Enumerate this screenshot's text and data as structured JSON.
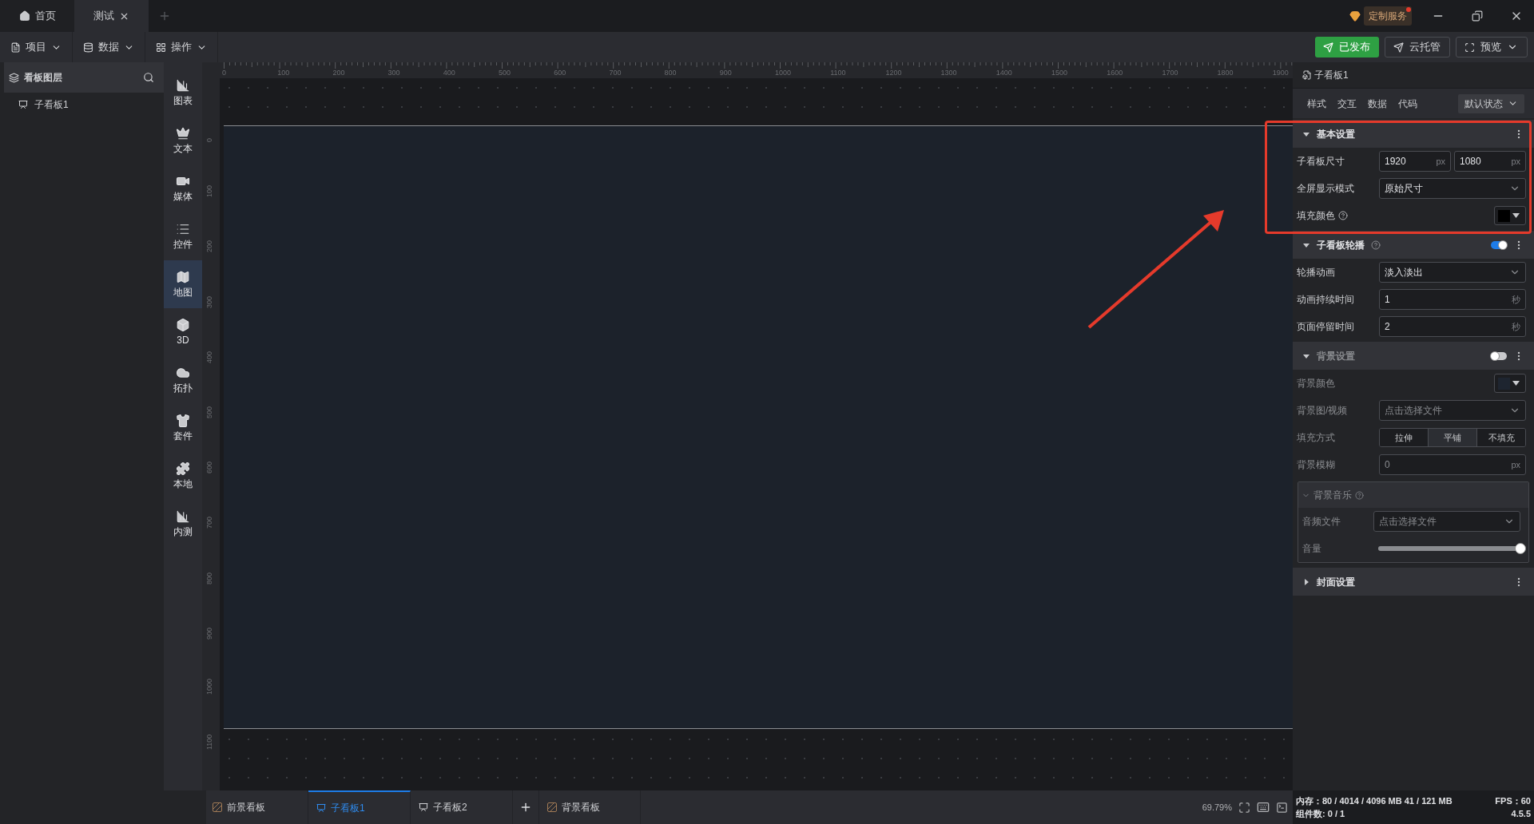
{
  "tabs": [
    {
      "label": "首页",
      "kind": "home",
      "selected": false
    },
    {
      "label": "测试",
      "kind": "doc",
      "selected": true
    }
  ],
  "custom_service": {
    "label": "定制服务",
    "notification": true
  },
  "menus": [
    "项目",
    "数据",
    "操作"
  ],
  "actions": [
    {
      "label": "已发布",
      "kind": "primary"
    },
    {
      "label": "云托管",
      "kind": "outline"
    },
    {
      "label": "预览",
      "kind": "dropdown"
    }
  ],
  "layers_panel": {
    "title": "看板图层",
    "items": [
      {
        "label": "子看板1"
      }
    ]
  },
  "component_bar": [
    {
      "label": "图表",
      "selected": false
    },
    {
      "label": "文本",
      "selected": false
    },
    {
      "label": "媒体",
      "selected": false
    },
    {
      "label": "控件",
      "selected": false
    },
    {
      "label": "地图",
      "selected": true
    },
    {
      "label": "3D",
      "selected": false
    },
    {
      "label": "拓扑",
      "selected": false
    },
    {
      "label": "套件",
      "selected": false
    },
    {
      "label": "本地",
      "selected": false
    },
    {
      "label": "内测",
      "selected": false
    }
  ],
  "ruler": {
    "x_labels": [
      "0",
      "100",
      "200",
      "300",
      "400",
      "500",
      "600",
      "700",
      "800",
      "900",
      "1000",
      "1100",
      "1200",
      "1300",
      "1400",
      "1500",
      "1600",
      "1700",
      "1800",
      "1900"
    ],
    "y_labels": [
      "0",
      "100",
      "200",
      "300",
      "400",
      "500",
      "600",
      "700",
      "800",
      "900",
      "1000",
      "1100"
    ]
  },
  "properties": {
    "title": "子看板1",
    "tabs": [
      "样式",
      "交互",
      "数据",
      "代码"
    ],
    "state_select": "默认状态",
    "sections": [
      {
        "title": "基本设置",
        "expanded": true,
        "rows": [
          {
            "kind": "size",
            "label": "子看板尺寸",
            "values": [
              {
                "value": "1920",
                "unit": "px"
              },
              {
                "value": "1080",
                "unit": "px"
              }
            ]
          },
          {
            "kind": "select",
            "label": "全屏显示模式",
            "value": "原始尺寸"
          },
          {
            "kind": "color",
            "label": "填充颜色",
            "help": true,
            "color": "#000000"
          }
        ]
      },
      {
        "title": "子看板轮播",
        "expanded": true,
        "help": true,
        "toggle": true,
        "rows": [
          {
            "kind": "select",
            "label": "轮播动画",
            "value": "淡入淡出"
          },
          {
            "kind": "number",
            "label": "动画持续时间",
            "value": "1",
            "unit": "秒"
          },
          {
            "kind": "number",
            "label": "页面停留时间",
            "value": "2",
            "unit": "秒"
          }
        ]
      },
      {
        "title": "背景设置",
        "expanded": true,
        "toggle": false,
        "rows": [
          {
            "kind": "color",
            "label": "背景颜色",
            "color": "#1e2530"
          },
          {
            "kind": "select",
            "label": "背景图/视频",
            "value": "点击选择文件"
          },
          {
            "kind": "segmented",
            "label": "填充方式",
            "options": [
              {
                "label": "拉伸",
                "selected": false
              },
              {
                "label": "平铺",
                "selected": true
              },
              {
                "label": "不填充",
                "selected": false
              }
            ]
          },
          {
            "kind": "number",
            "label": "背景模糊",
            "value": "0",
            "unit": "px"
          },
          {
            "kind": "group",
            "title": "背景音乐",
            "help": true,
            "expanded": true,
            "rows": [
              {
                "kind": "select",
                "label": "音频文件",
                "value": "点击选择文件"
              },
              {
                "kind": "slider",
                "label": "音量",
                "level": 1
              }
            ]
          }
        ]
      },
      {
        "title": "封面设置",
        "expanded": false
      }
    ]
  },
  "bottom_bar": {
    "foreground": "前景看板",
    "boards": [
      {
        "label": "子看板1",
        "selected": true
      },
      {
        "label": "子看板2",
        "selected": false
      }
    ],
    "background": "背景看板",
    "zoom": "69.79%",
    "memory": "内存：80 / 4014 / 4096 MB  41 / 121 MB",
    "fps": "FPS：60",
    "components": "组件数: 0 / 1",
    "version": "4.5.5"
  }
}
